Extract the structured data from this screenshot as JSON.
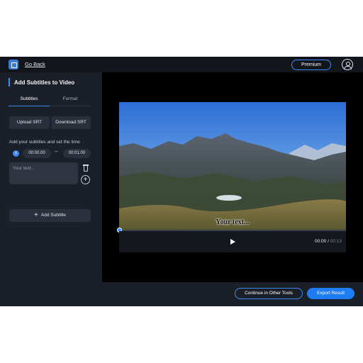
{
  "header": {
    "back_label": "Go Back",
    "premium_label": "Premium",
    "logo_icon": "app-logo-icon",
    "avatar_icon": "user-avatar-icon"
  },
  "sidebar": {
    "title": "Add Subtitles to Video",
    "tabs": [
      {
        "label": "Subtitles",
        "active": true
      },
      {
        "label": "Format",
        "active": false
      }
    ],
    "upload_label": "Upload SRT",
    "download_label": "Download SRT",
    "hint": "Add your subtitles and set the time",
    "start_time": "00:00.00",
    "end_time": "00:01.00",
    "separator": "–",
    "subtitle_placeholder": "Your text...",
    "add_subtitle_label": "Add Subtitle"
  },
  "player": {
    "caption": "Your text...",
    "current_time": "00:00",
    "time_separator": " / ",
    "duration": "00:13",
    "progress": 0
  },
  "footer": {
    "continue_label": "Continue in Other Tools",
    "export_label": "Export Result"
  },
  "colors": {
    "accent": "#3d8bff",
    "export_bg": "#1e7cf5",
    "sidebar_bg": "#1b1f28",
    "main_bg": "#000000"
  }
}
